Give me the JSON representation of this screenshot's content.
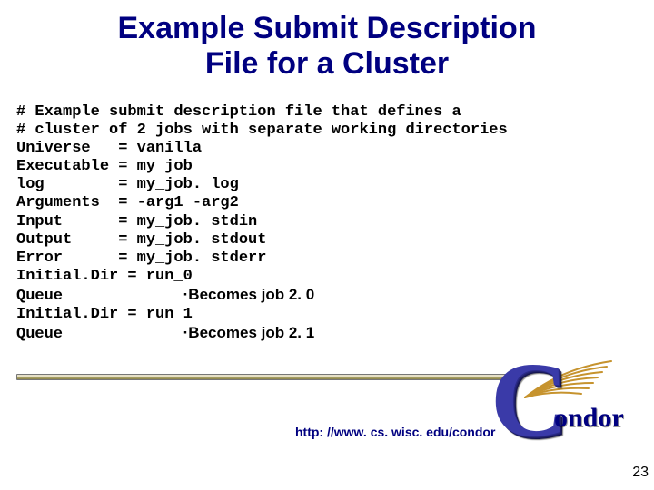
{
  "title_line1": "Example Submit Description",
  "title_line2": "File for a Cluster",
  "code": {
    "l1": "# Example submit description file that defines a",
    "l2": "# cluster of 2 jobs with separate working directories",
    "l3": "Universe   = vanilla",
    "l4": "Executable = my_job",
    "l5": "log        = my_job. log",
    "l6": "Arguments  = -arg1 -arg2",
    "l7": "Input      = my_job. stdin",
    "l8": "Output     = my_job. stdout",
    "l9": "Error      = my_job. stderr",
    "l10": "Initial.Dir = run_0",
    "l11": "Queue",
    "a11": "·Becomes job 2. 0",
    "l12": "Initial.Dir = run_1",
    "l13": "Queue",
    "a13": "·Becomes job 2. 1"
  },
  "url": "http: //www. cs. wisc. edu/condor",
  "slide_number": "23",
  "logo": {
    "big_c": "C",
    "rest": "ondor"
  }
}
